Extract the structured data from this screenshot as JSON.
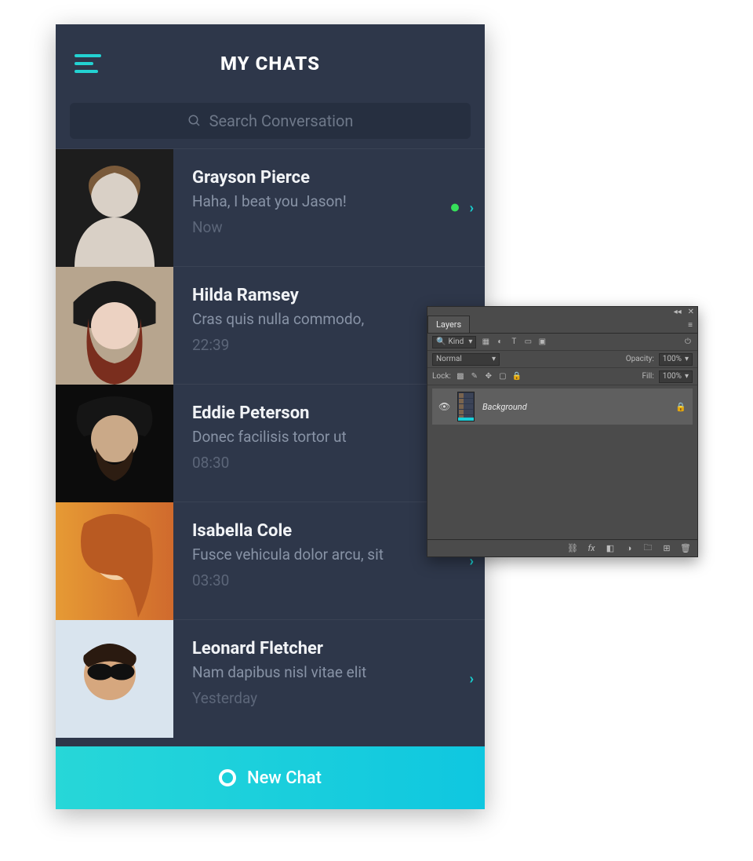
{
  "chat_app": {
    "title": "MY CHATS",
    "search_placeholder": "Search Conversation",
    "new_chat_label": "New Chat",
    "rows": [
      {
        "name": "Grayson Pierce",
        "message": "Haha, I beat you Jason!",
        "time": "Now",
        "online": true,
        "chevron": true
      },
      {
        "name": "Hilda Ramsey",
        "message": "Cras quis nulla commodo,",
        "time": "22:39",
        "online": false,
        "chevron": false
      },
      {
        "name": "Eddie Peterson",
        "message": "Donec facilisis tortor ut",
        "time": "08:30",
        "online": false,
        "chevron": false
      },
      {
        "name": "Isabella Cole",
        "message": "Fusce vehicula dolor arcu, sit",
        "time": "03:30",
        "online": false,
        "chevron": true
      },
      {
        "name": "Leonard Fletcher",
        "message": "Nam dapibus nisl vitae elit",
        "time": "Yesterday",
        "online": false,
        "chevron": true
      }
    ]
  },
  "layers_panel": {
    "tab_label": "Layers",
    "filter_label": "Kind",
    "blend_mode": "Normal",
    "opacity_label": "Opacity:",
    "opacity_value": "100%",
    "lock_label": "Lock:",
    "fill_label": "Fill:",
    "fill_value": "100%",
    "layer_name": "Background",
    "footer_link": "fx",
    "footer_chain": "⛓"
  }
}
